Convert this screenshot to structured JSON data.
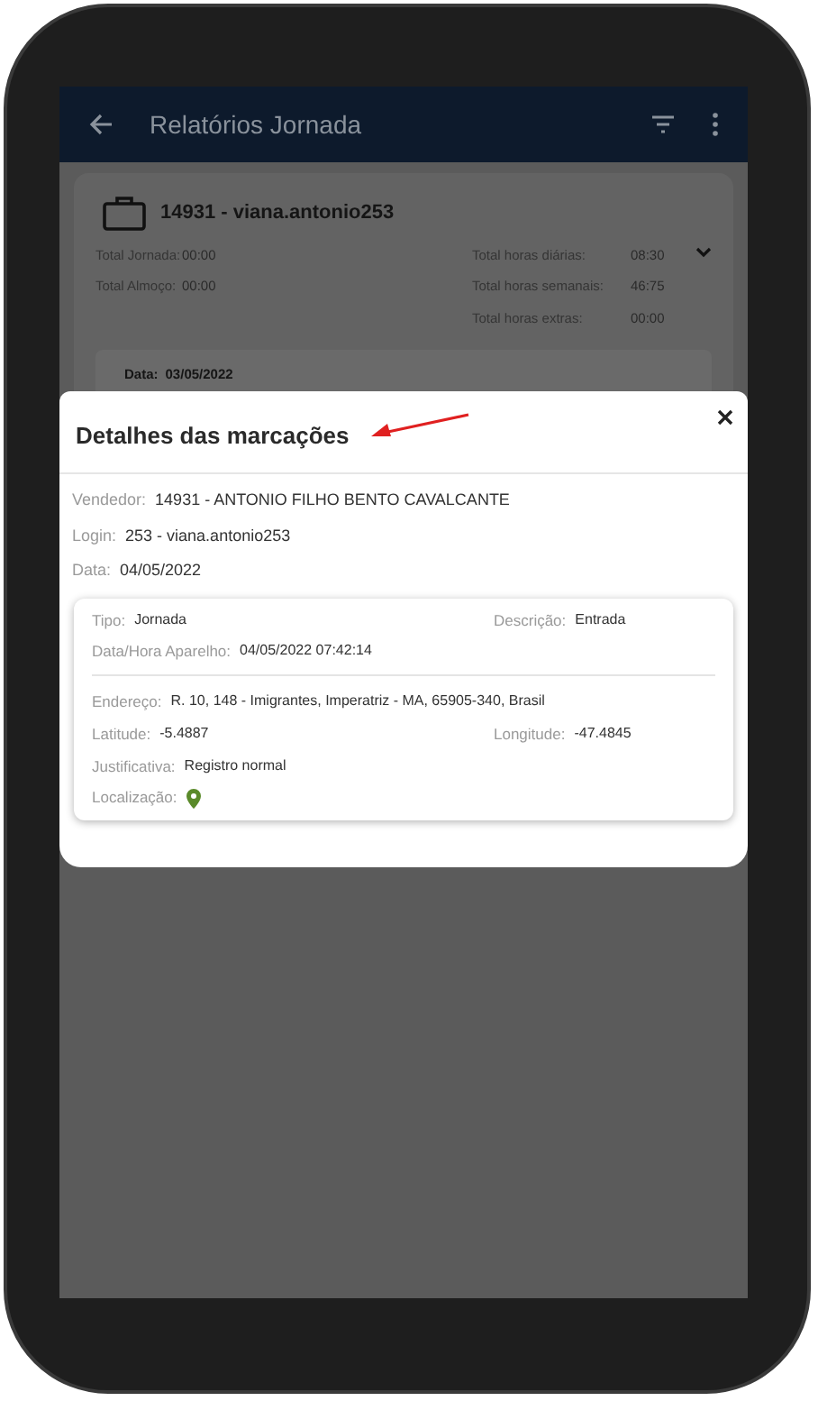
{
  "app_bar": {
    "title": "Relatórios Jornada"
  },
  "summary_card": {
    "title": "14931 - viana.antonio253",
    "left_stats": [
      {
        "label": "Total Jornada:",
        "value": "00:00"
      },
      {
        "label": "Total Almoço:",
        "value": "00:00"
      }
    ],
    "right_stats": [
      {
        "label": "Total horas diárias:",
        "value": "08:30"
      },
      {
        "label": "Total horas semanais:",
        "value": "46:75"
      },
      {
        "label": "Total horas extras:",
        "value": "00:00"
      }
    ],
    "day": {
      "label": "Data:",
      "value": "03/05/2022"
    }
  },
  "modal": {
    "title": "Detalhes das marcações",
    "fields": [
      {
        "label": "Vendedor:",
        "value": "14931 - ANTONIO FILHO BENTO CAVALCANTE"
      },
      {
        "label": "Login:",
        "value": "253 - viana.antonio253"
      },
      {
        "label": "Data:",
        "value": "04/05/2022"
      }
    ],
    "record": {
      "tipo": {
        "label": "Tipo:",
        "value": "Jornada"
      },
      "descricao": {
        "label": "Descrição:",
        "value": "Entrada"
      },
      "device_time": {
        "label": "Data/Hora Aparelho:",
        "value": "04/05/2022 07:42:14"
      },
      "endereco": {
        "label": "Endereço:",
        "value": "R. 10, 148 - Imigrantes, Imperatriz - MA, 65905-340, Brasil"
      },
      "latitude": {
        "label": "Latitude:",
        "value": "-5.4887"
      },
      "longitude": {
        "label": "Longitude:",
        "value": "-47.4845"
      },
      "justificativa": {
        "label": "Justificativa:",
        "value": "Registro normal"
      },
      "localizacao": {
        "label": "Localização:"
      }
    }
  }
}
